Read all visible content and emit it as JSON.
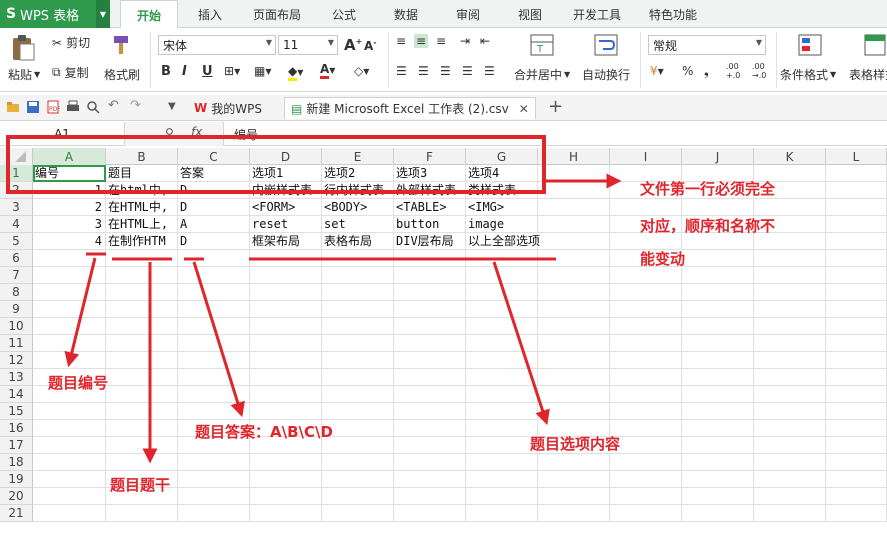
{
  "app": {
    "title": "WPS 表格",
    "logo": "S"
  },
  "ribbon_tabs": [
    "开始",
    "插入",
    "页面布局",
    "公式",
    "数据",
    "审阅",
    "视图",
    "开发工具",
    "特色功能"
  ],
  "ribbon": {
    "paste": "粘贴",
    "cut": "剪切",
    "copy": "复制",
    "format_painter": "格式刷",
    "font_name": "宋体",
    "font_size": "11",
    "bold": "B",
    "italic": "I",
    "underline": "U",
    "merge_center": "合并居中",
    "wrap_text": "自动换行",
    "number_format": "常规",
    "percent": "%",
    "comma": "❟",
    "inc_decimal": ".00\n+.0",
    "dec_decimal": ".00\n→.0",
    "conditional_format": "条件格式",
    "table_style": "表格样式",
    "grow_font": "A",
    "shrink_font": "A"
  },
  "doc_tabs": [
    {
      "label": "我的WPS"
    },
    {
      "label": "新建 Microsoft Excel 工作表 (2).csv"
    }
  ],
  "formula_bar": {
    "name_box": "A1",
    "fx": "fx",
    "content": "编号"
  },
  "columns": [
    "A",
    "B",
    "C",
    "D",
    "E",
    "F",
    "G",
    "H",
    "I",
    "J",
    "K",
    "L"
  ],
  "rows": [
    "1",
    "2",
    "3",
    "4",
    "5",
    "6",
    "7",
    "8",
    "9",
    "10",
    "11",
    "12",
    "13",
    "14",
    "15",
    "16",
    "17",
    "18",
    "19",
    "20",
    "21"
  ],
  "cells": [
    [
      "编号",
      "题目",
      "答案",
      "选项1",
      "选项2",
      "选项3",
      "选项4"
    ],
    [
      "1",
      "在html中,",
      "D",
      "内嵌样式表",
      "行内样式表",
      "外部样式表",
      "类样式表"
    ],
    [
      "2",
      "在HTML中,",
      "D",
      "<FORM>",
      "<BODY>",
      "<TABLE>",
      "<IMG>"
    ],
    [
      "3",
      "在HTML上,",
      "A",
      "reset",
      "set",
      "button",
      "image"
    ],
    [
      "4",
      "在制作HTM",
      "D",
      "框架布局",
      "表格布局",
      "DIV层布局",
      "以上全部选项"
    ]
  ],
  "annotations": {
    "header_note_line1": "文件第一行必须完全",
    "header_note_line2": "对应，顺序和名称不",
    "header_note_line3": "能变动",
    "id_note": "题目编号",
    "stem_note": "题目题干",
    "answer_note": "题目答案：A\\B\\C\\D",
    "options_note": "题目选项内容"
  },
  "colors": {
    "brand": "#2f9a4c",
    "annotation": "#e0262c"
  }
}
